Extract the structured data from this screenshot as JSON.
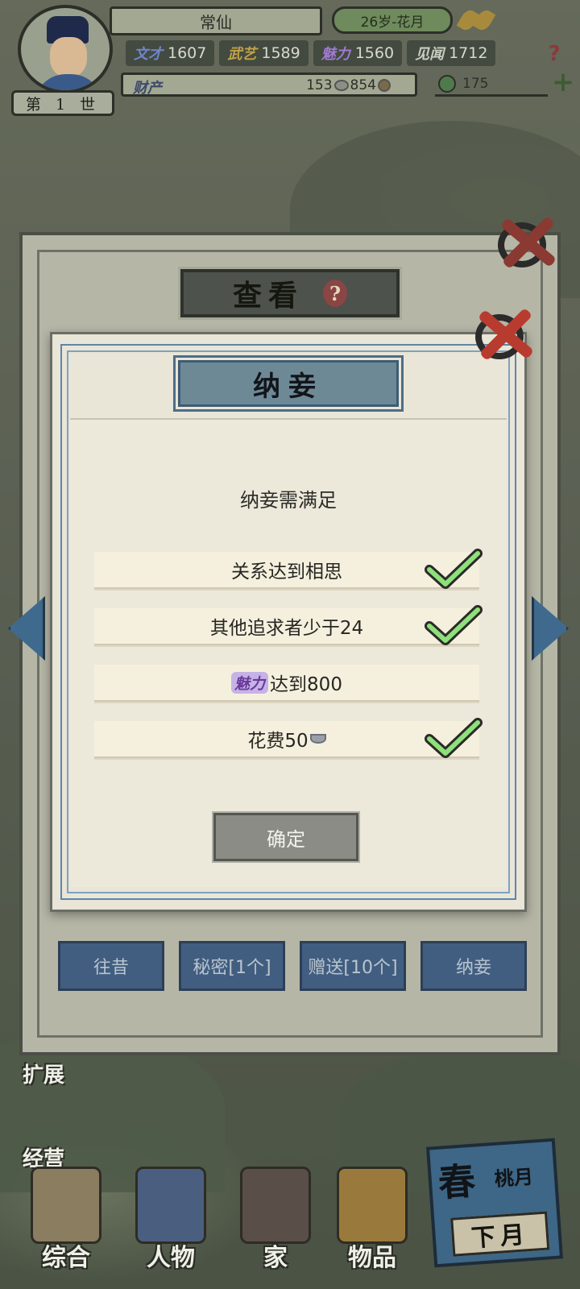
{
  "player": {
    "generation": "第 1 世",
    "name": "常仙",
    "age_season": "26岁-花月"
  },
  "stats": [
    {
      "label": "文才",
      "value": "1607",
      "color": "#6f86c8"
    },
    {
      "label": "武艺",
      "value": "1589",
      "color": "#c0a24a"
    },
    {
      "label": "魅力",
      "value": "1560",
      "color": "#a07ad0"
    },
    {
      "label": "见闻",
      "value": "1712",
      "color": "#c9cfc0"
    }
  ],
  "wealth": {
    "label": "财产",
    "silver": "153",
    "coins": "854",
    "jade": "175"
  },
  "outer_panel": {
    "title": "查看",
    "help": "?",
    "tabs": [
      "往昔",
      "秘密[1个]",
      "赠送[10个]",
      "纳妾"
    ]
  },
  "dialog": {
    "title": "纳妾",
    "subtitle": "纳妾需满足",
    "requirements": [
      {
        "text": "关系达到相思",
        "met": true
      },
      {
        "text": "其他追求者少于24",
        "met": true
      },
      {
        "prefix": "魅力",
        "text": "达到800",
        "met": false
      },
      {
        "text": "花费50",
        "met": true
      }
    ],
    "confirm_label": "确定"
  },
  "side_labels": {
    "expand": "扩展",
    "business": "经营"
  },
  "bottom_nav": [
    {
      "label": "综合"
    },
    {
      "label": "人物"
    },
    {
      "label": "家"
    },
    {
      "label": "物品"
    }
  ],
  "season": {
    "season": "春",
    "month": "桃月",
    "next_label": "下月"
  }
}
